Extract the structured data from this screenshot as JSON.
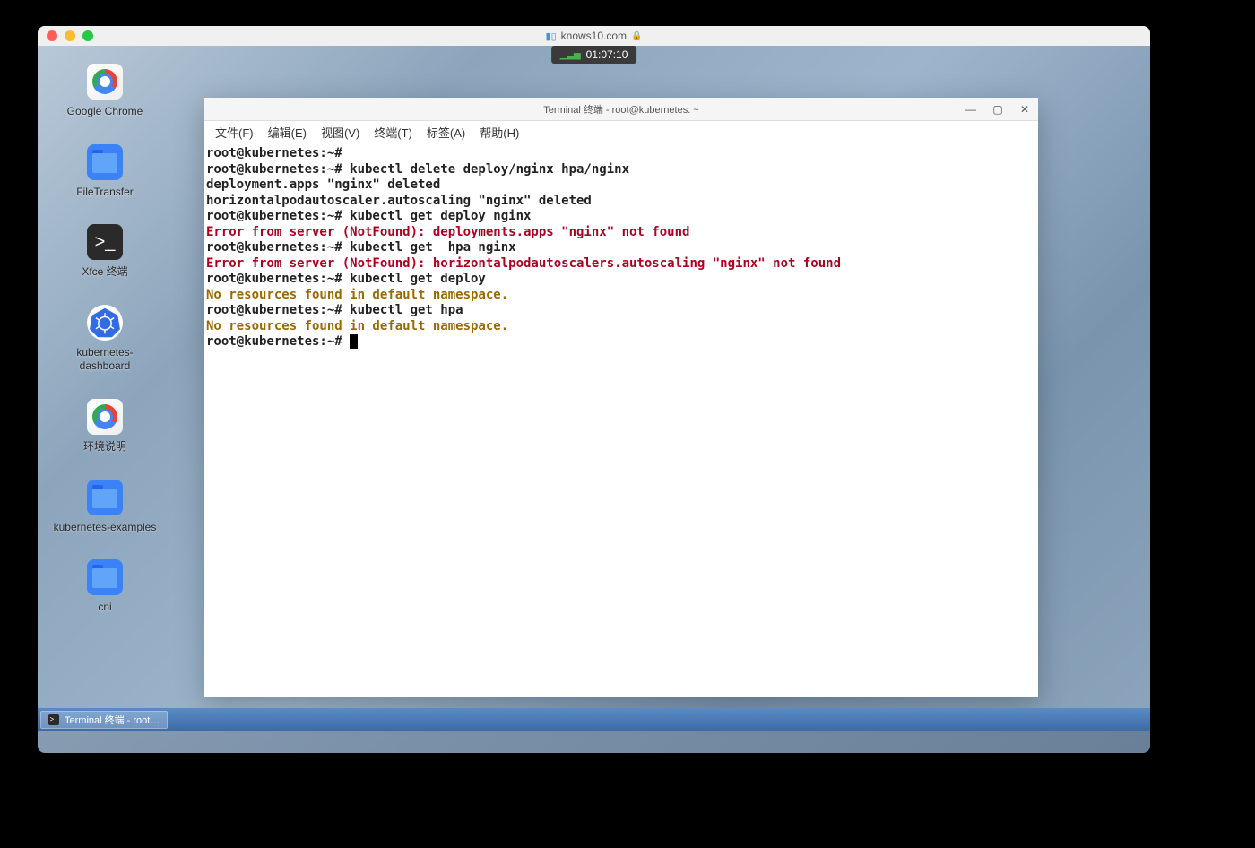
{
  "browser": {
    "url": "knows10.com",
    "timer": "01:07:10"
  },
  "desktop_icons": [
    {
      "id": "chrome",
      "label": "Google Chrome"
    },
    {
      "id": "filetransfer",
      "label": "FileTransfer"
    },
    {
      "id": "xfce-terminal",
      "label": "Xfce 终端"
    },
    {
      "id": "k8s-dashboard",
      "label": "kubernetes-dashboard"
    },
    {
      "id": "env-desc",
      "label": "环境说明"
    },
    {
      "id": "k8s-examples",
      "label": "kubernetes-examples"
    },
    {
      "id": "cni",
      "label": "cni"
    }
  ],
  "terminal": {
    "title": "Terminal 终端 - root@kubernetes: ~",
    "menu": [
      "文件(F)",
      "编辑(E)",
      "视图(V)",
      "终端(T)",
      "标签(A)",
      "帮助(H)"
    ],
    "lines": [
      {
        "style": "bold",
        "text": "root@kubernetes:~#"
      },
      {
        "style": "bold",
        "text": "root@kubernetes:~# kubectl delete deploy/nginx hpa/nginx"
      },
      {
        "style": "bold",
        "text": "deployment.apps \"nginx\" deleted"
      },
      {
        "style": "bold",
        "text": "horizontalpodautoscaler.autoscaling \"nginx\" deleted"
      },
      {
        "style": "bold",
        "text": "root@kubernetes:~# kubectl get deploy nginx"
      },
      {
        "style": "err",
        "text": "Error from server (NotFound): deployments.apps \"nginx\" not found"
      },
      {
        "style": "bold",
        "text": "root@kubernetes:~# kubectl get  hpa nginx"
      },
      {
        "style": "err",
        "text": "Error from server (NotFound): horizontalpodautoscalers.autoscaling \"nginx\" not found"
      },
      {
        "style": "bold",
        "text": "root@kubernetes:~# kubectl get deploy"
      },
      {
        "style": "warn",
        "text": "No resources found in default namespace."
      },
      {
        "style": "bold",
        "text": "root@kubernetes:~# kubectl get hpa"
      },
      {
        "style": "warn",
        "text": "No resources found in default namespace."
      },
      {
        "style": "bold",
        "text": "root@kubernetes:~# ",
        "cursor": true
      }
    ]
  },
  "taskbar": {
    "item": "Terminal 终端 - root…"
  }
}
